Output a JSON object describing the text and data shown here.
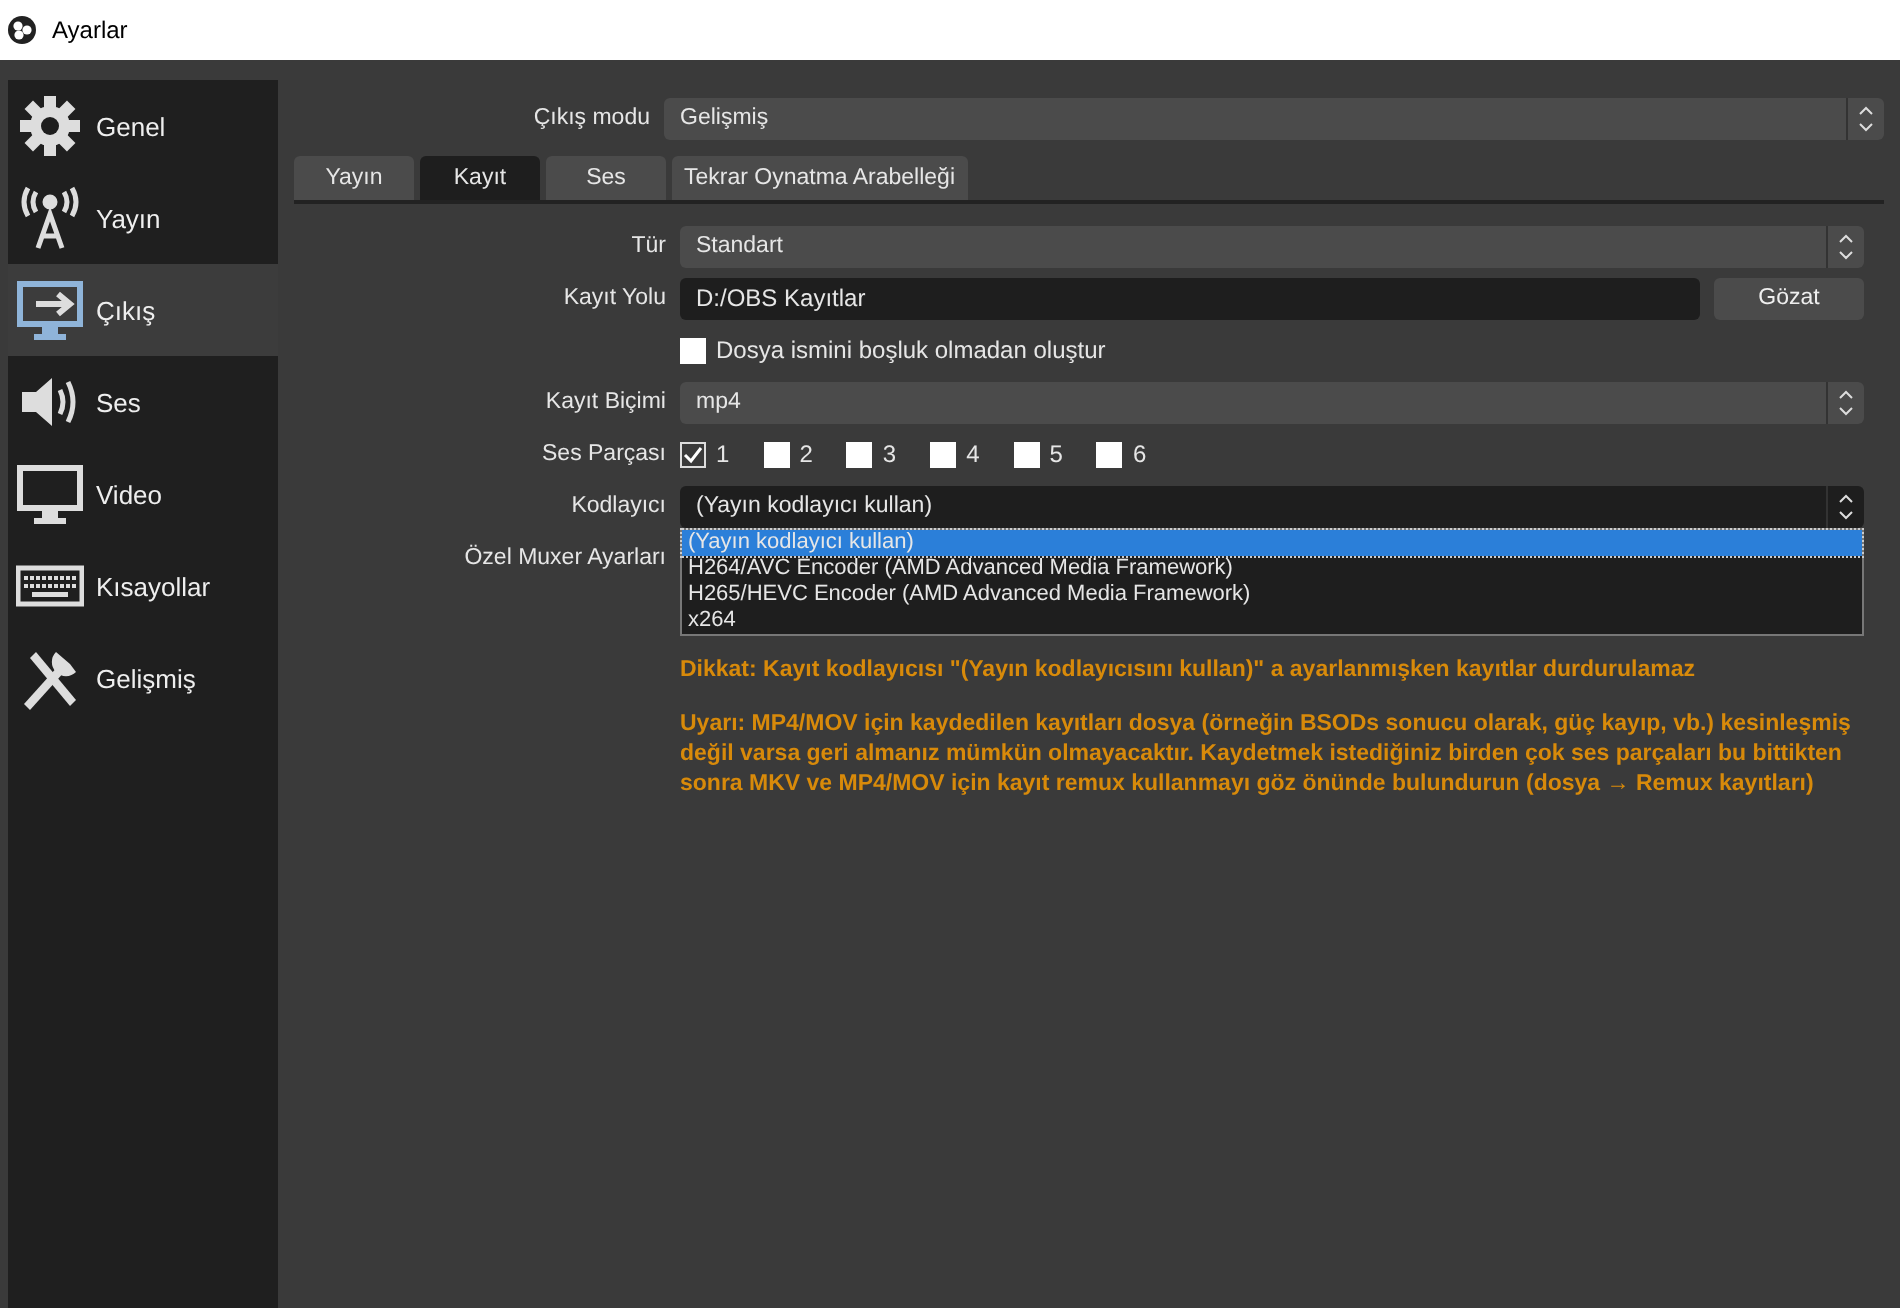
{
  "window": {
    "title": "Ayarlar"
  },
  "sidebar": {
    "items": [
      {
        "label": "Genel",
        "selected": false
      },
      {
        "label": "Yayın",
        "selected": false
      },
      {
        "label": "Çıkış",
        "selected": true
      },
      {
        "label": "Ses",
        "selected": false
      },
      {
        "label": "Video",
        "selected": false
      },
      {
        "label": "Kısayollar",
        "selected": false
      },
      {
        "label": "Gelişmiş",
        "selected": false
      }
    ]
  },
  "output_mode": {
    "label": "Çıkış modu",
    "value": "Gelişmiş"
  },
  "tabs": [
    {
      "label": "Yayın",
      "selected": false
    },
    {
      "label": "Kayıt",
      "selected": true
    },
    {
      "label": "Ses",
      "selected": false
    },
    {
      "label": "Tekrar Oynatma Arabelleği",
      "selected": false
    }
  ],
  "type": {
    "label": "Tür",
    "value": "Standart"
  },
  "path": {
    "label": "Kayıt Yolu",
    "value": "D:/OBS Kayıtlar",
    "button": "Gözat"
  },
  "no_space": {
    "label": "Dosya ismini boşluk olmadan oluştur",
    "checked": false
  },
  "format": {
    "label": "Kayıt Biçimi",
    "value": "mp4"
  },
  "audio_tracks": {
    "label": "Ses Parçası",
    "tracks": [
      {
        "label": "1",
        "checked": true
      },
      {
        "label": "2",
        "checked": false
      },
      {
        "label": "3",
        "checked": false
      },
      {
        "label": "4",
        "checked": false
      },
      {
        "label": "5",
        "checked": false
      },
      {
        "label": "6",
        "checked": false
      }
    ]
  },
  "encoder": {
    "label": "Kodlayıcı",
    "value": "(Yayın kodlayıcı kullan)",
    "expanded": true,
    "options": [
      {
        "label": "(Yayın kodlayıcı kullan)",
        "selected": true
      },
      {
        "label": "H264/AVC Encoder (AMD Advanced Media Framework)",
        "selected": false
      },
      {
        "label": "H265/HEVC Encoder (AMD Advanced Media Framework)",
        "selected": false
      },
      {
        "label": "x264",
        "selected": false
      }
    ]
  },
  "muxer": {
    "label": "Özel Muxer Ayarları"
  },
  "notes": [
    "Dikkat: Kayıt kodlayıcısı \"(Yayın kodlayıcısını kullan)\" a ayarlanmışken kayıtlar durdurulamaz",
    "Uyarı: MP4/MOV için kaydedilen kayıtları dosya (örneğin BSODs sonucu olarak, güç kayıp, vb.) kesinleşmiş değil varsa geri almanız mümkün olmayacaktır. Kaydetmek istediğiniz birden çok ses parçaları bu bittikten sonra MKV ve MP4/MOV için kayıt remux kullanmayı göz önünde bulundurun (dosya → Remux kayıtları)"
  ]
}
